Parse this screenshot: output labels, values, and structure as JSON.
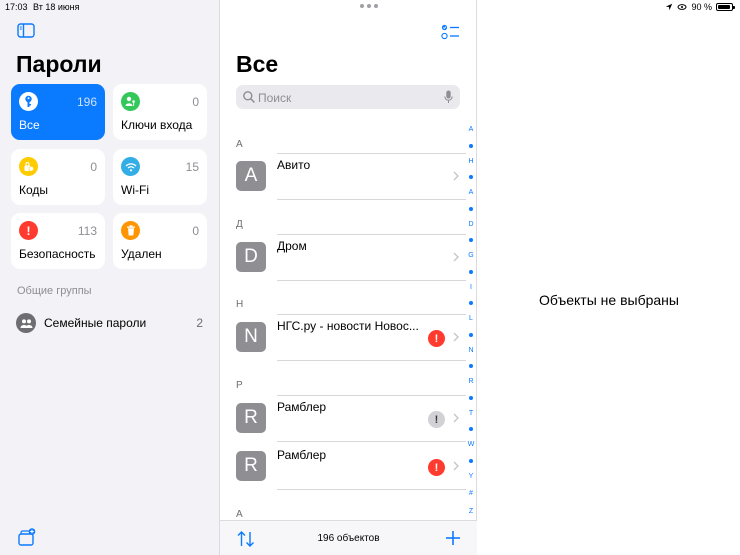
{
  "status_bar": {
    "time": "17:03",
    "date": "Вт 18 июня",
    "battery": "90 %",
    "battery_level": 0.9
  },
  "sidebar": {
    "title": "Пароли",
    "tiles": [
      {
        "label": "Все",
        "count": "196",
        "icon": "key-icon",
        "color": "#0a7aff"
      },
      {
        "label": "Ключи входа",
        "count": "0",
        "icon": "person-key-icon",
        "color": "#34c759"
      },
      {
        "label": "Коды",
        "count": "0",
        "icon": "lock-clock-icon",
        "color": "#ffcc00"
      },
      {
        "label": "Wi-Fi",
        "count": "15",
        "icon": "wifi-icon",
        "color": "#32ade6"
      },
      {
        "label": "Безопасность",
        "count": "113",
        "icon": "exclamation-icon",
        "color": "#ff3b30"
      },
      {
        "label": "Удален",
        "count": "0",
        "icon": "trash-icon",
        "color": "#ff9500"
      }
    ],
    "groups_header": "Общие группы",
    "groups": [
      {
        "label": "Семейные пароли",
        "count": "2",
        "icon": "people-icon"
      }
    ]
  },
  "list": {
    "title": "Все",
    "search_placeholder": "Поиск",
    "sections": [
      {
        "header": "А",
        "items": [
          {
            "letter": "A",
            "title": "Авито",
            "warning": ""
          }
        ]
      },
      {
        "header": "Д",
        "items": [
          {
            "letter": "D",
            "title": "Дром",
            "warning": ""
          }
        ]
      },
      {
        "header": "Н",
        "items": [
          {
            "letter": "N",
            "title": "НГС.ру - новости Новос...",
            "warning": "red"
          }
        ]
      },
      {
        "header": "Р",
        "items": [
          {
            "letter": "R",
            "title": "Рамблер",
            "warning": "grey"
          },
          {
            "letter": "R",
            "title": "Рамблер",
            "warning": "red"
          }
        ]
      },
      {
        "header": "А",
        "items": []
      }
    ],
    "index_letters": [
      "A",
      "•",
      "H",
      "•",
      "A",
      "•",
      "D",
      "•",
      "G",
      "•",
      "I",
      "•",
      "L",
      "•",
      "N",
      "•",
      "R",
      "•",
      "T",
      "•",
      "W",
      "•",
      "Y",
      "#",
      "Z"
    ],
    "footer_count": "196 объектов"
  },
  "detail": {
    "empty_text": "Объекты не выбраны"
  },
  "colors": {
    "accent": "#0a7aff",
    "warning_red": "#ff3b30",
    "sidebar_bg": "#f2f2f7"
  }
}
